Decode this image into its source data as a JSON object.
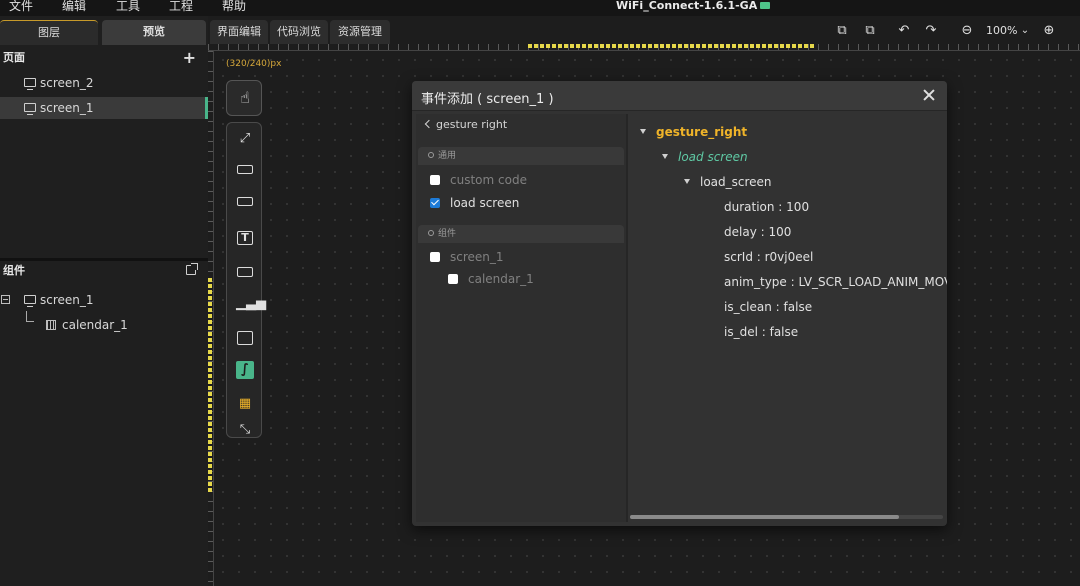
{
  "menubar": {
    "items": [
      "文件",
      "编辑",
      "工具",
      "工程",
      "帮助"
    ],
    "app_title": "WiFi_Connect-1.6.1-GA"
  },
  "left_panel": {
    "tabs": [
      "图层",
      "预览"
    ],
    "pages_section": {
      "title": "页面",
      "items": [
        "screen_2",
        "screen_1"
      ],
      "selected": "screen_1"
    },
    "widgets_section": {
      "title": "组件",
      "tree": [
        {
          "label": "screen_1",
          "children": [
            "calendar_1"
          ]
        }
      ]
    }
  },
  "editor": {
    "tabs": [
      "界面编辑",
      "代码浏览",
      "资源管理"
    ],
    "zoom": "100%",
    "canvas_size": "(320/240)px",
    "toolbar_icons": [
      "layer-back-icon",
      "layer-front-icon",
      "undo-icon",
      "redo-icon",
      "zoom-out-icon",
      "zoom-dropdown-icon",
      "zoom-in-icon"
    ],
    "tool_icons": [
      "touch-icon",
      "shrink-icon",
      "button-icon",
      "imgbutton-icon",
      "text-icon",
      "dropdown-icon",
      "chart-icon",
      "image-icon",
      "line-icon",
      "qrcode-icon",
      "expand-icon"
    ]
  },
  "dialog": {
    "title": "事件添加 ( screen_1 )",
    "back_label": "gesture right",
    "general_group": {
      "title": "通用",
      "options": [
        {
          "label": "custom code",
          "checked": false,
          "enabled": false
        },
        {
          "label": "load screen",
          "checked": true,
          "enabled": true
        }
      ]
    },
    "widget_group": {
      "title": "组件",
      "options": [
        {
          "label": "screen_1",
          "checked": false,
          "enabled": false
        },
        {
          "label": "calendar_1",
          "checked": false,
          "enabled": false
        }
      ]
    },
    "tree": {
      "root": "gesture_right",
      "event": "load screen",
      "action": "load_screen",
      "props": [
        "duration : 100",
        "delay : 100",
        "scrId : r0vj0eel",
        "anim_type : LV_SCR_LOAD_ANIM_MOVE_",
        "is_clean : false",
        "is_del : false"
      ]
    },
    "hscroll_fraction": 0.86
  },
  "colors": {
    "accent_green": "#49b58a",
    "root_orange": "#f0b429",
    "event_teal": "#5fc9a4",
    "checkbox_blue": "#1d7bd8",
    "ruler_yellow": "#e6d84a"
  }
}
